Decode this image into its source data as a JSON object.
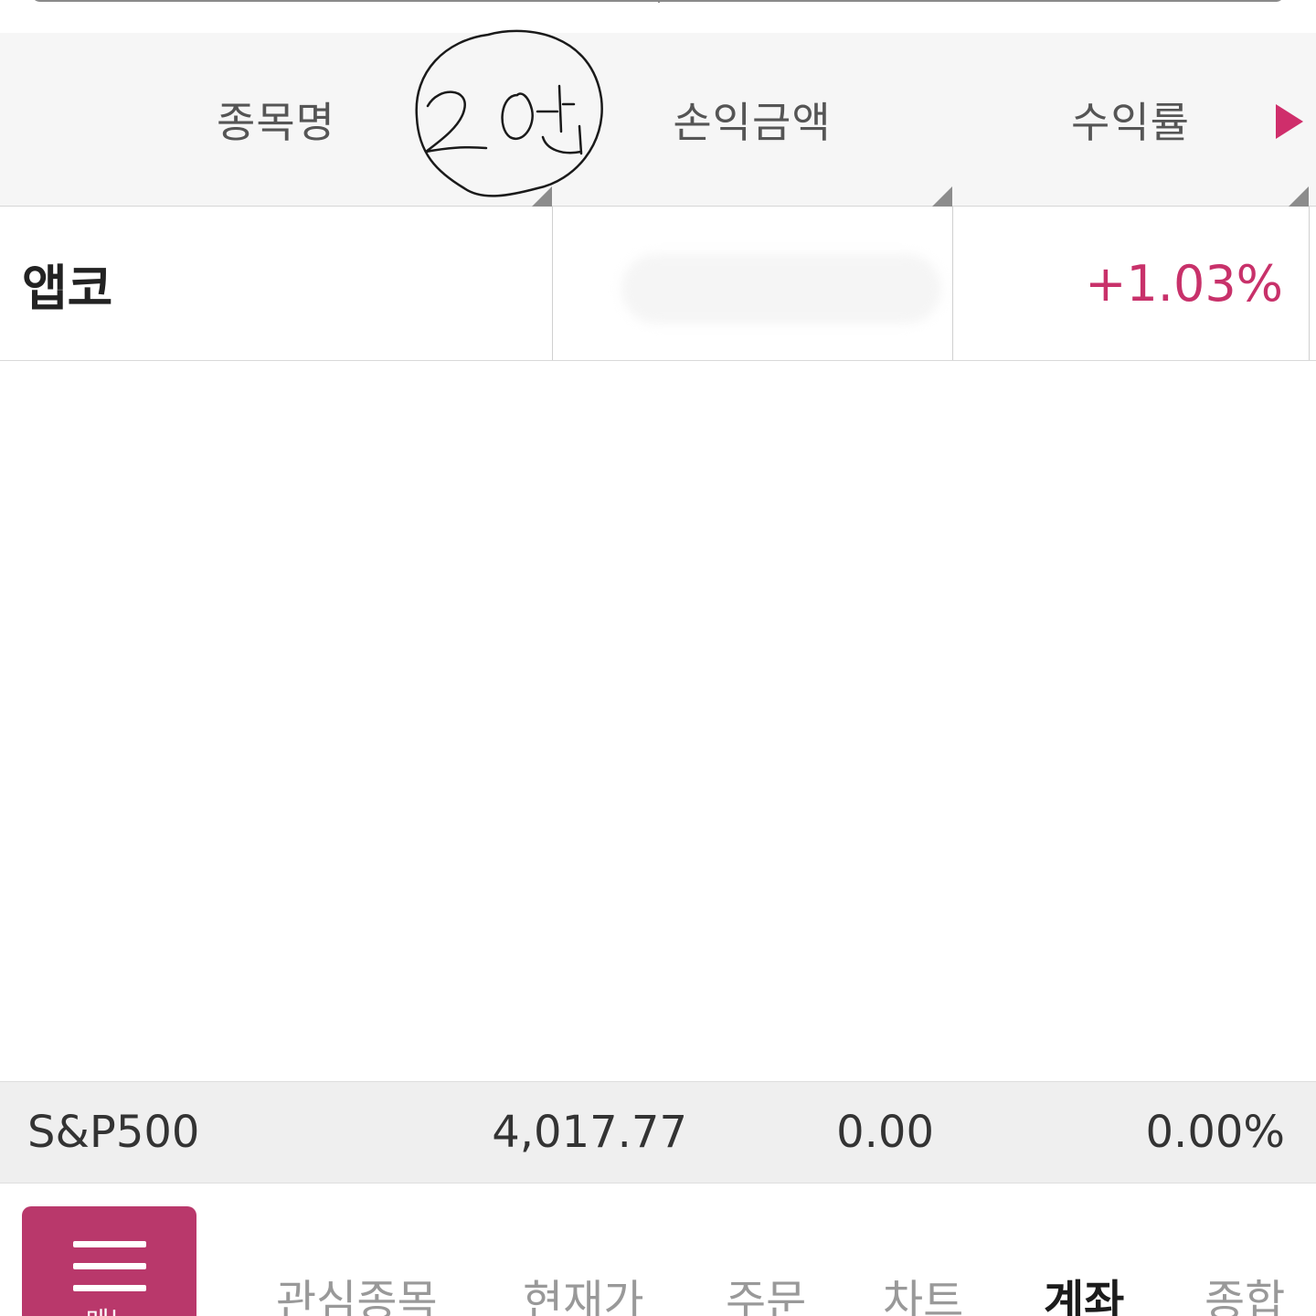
{
  "header": {
    "col_name": "종목명",
    "col_pl": "손익금액",
    "col_rate": "수익률"
  },
  "annotation": {
    "handwritten_text": "2연"
  },
  "rows": [
    {
      "name": "앱코",
      "pl": "",
      "rate": "+1.03%"
    }
  ],
  "ticker": {
    "name": "S&P500",
    "price": "4,017.77",
    "change": "0.00",
    "change_pct": "0.00%"
  },
  "bottom_nav": {
    "menu_label": "메뉴",
    "tabs": [
      "관심종목",
      "현재가",
      "주문",
      "차트",
      "계좌",
      "종합"
    ],
    "active_tab": "계좌"
  },
  "colors": {
    "accent": "#cf2e6b",
    "menu_button": "#b9386b",
    "positive_rate": "#c8316a"
  },
  "icons": {
    "next_columns": "next-arrow-icon",
    "menu": "hamburger-icon"
  }
}
